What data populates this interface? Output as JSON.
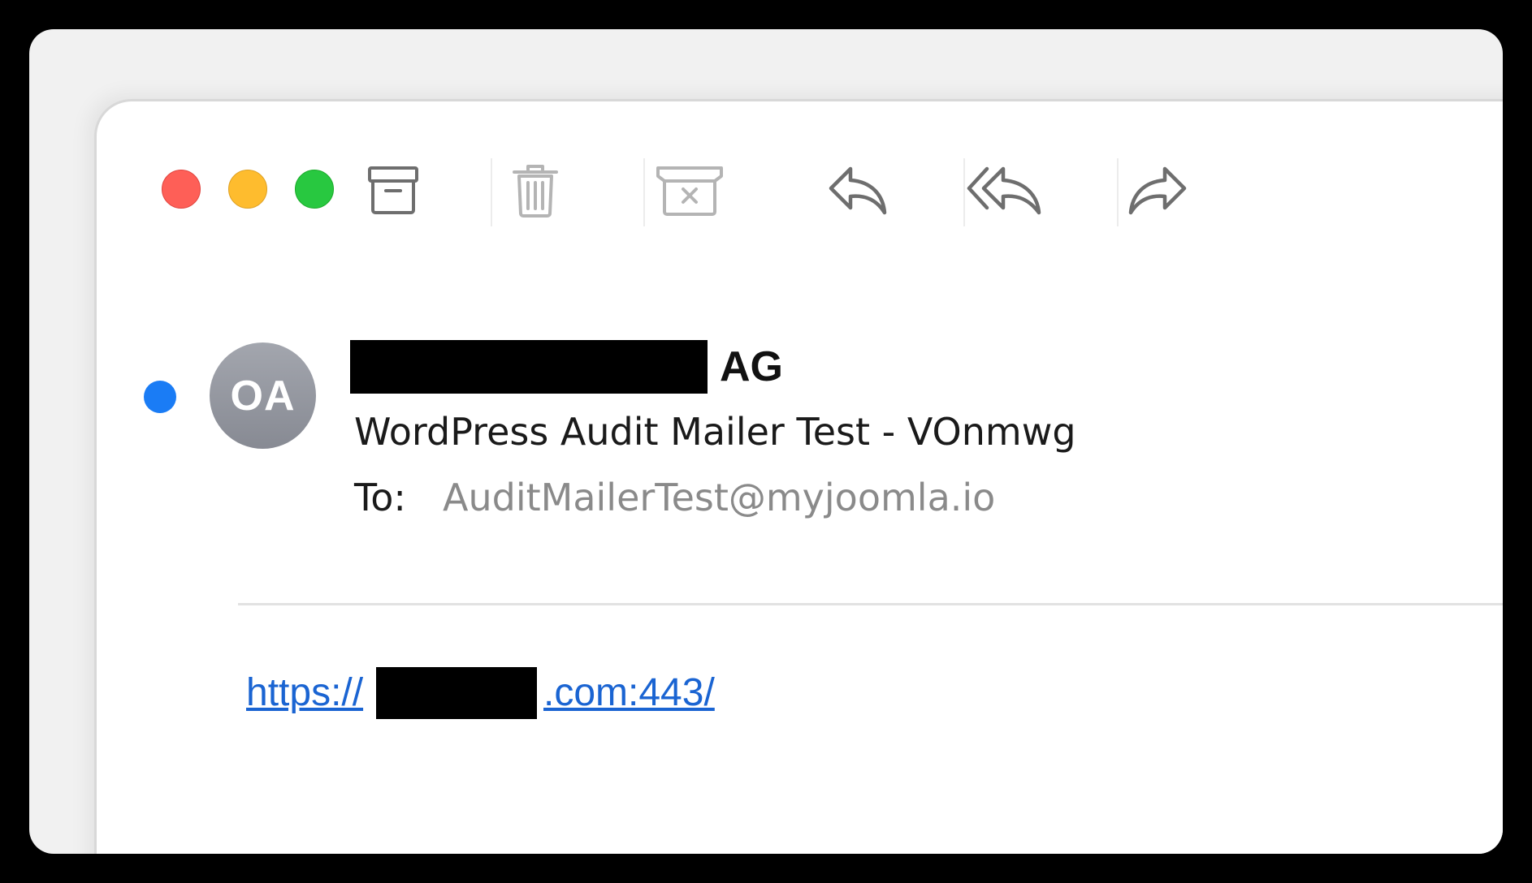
{
  "window": {
    "traffic_lights": [
      {
        "name": "close",
        "color": "#fe5f57"
      },
      {
        "name": "minimize",
        "color": "#febc2e"
      },
      {
        "name": "zoom",
        "color": "#28c840"
      }
    ]
  },
  "toolbar": {
    "icons": [
      "archive-icon",
      "trash-icon",
      "junk-icon",
      "reply-icon",
      "reply-all-icon",
      "forward-icon"
    ]
  },
  "message": {
    "unread": true,
    "unread_dot_color": "#1a7cf5",
    "avatar_initials": "OA",
    "sender_name_visible_suffix": "AG",
    "subject": "WordPress Audit Mailer Test - VOnmwg",
    "to_label": "To:",
    "to_address": "AuditMailerTest@myjoomla.io"
  },
  "body": {
    "link_prefix": "https://",
    "link_suffix": ".com:443/",
    "link_color": "#1a64d2"
  }
}
